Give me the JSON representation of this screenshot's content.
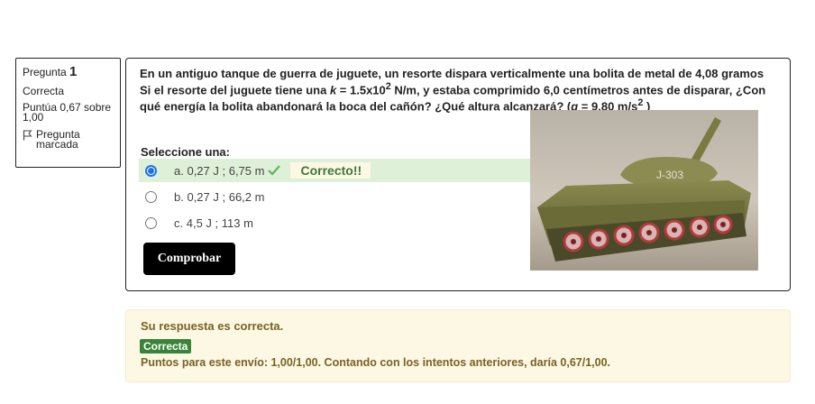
{
  "info": {
    "question_word": "Pregunta",
    "question_number": "1",
    "state": "Correcta",
    "grade": "Puntúa 0,67 sobre 1,00",
    "flag_label": "Pregunta marcada"
  },
  "question": {
    "p1": "En un antiguo tanque de guerra de juguete, un resorte dispara verticalmente una bolita de metal de 4,08 gramos  Si el resorte del juguete tiene una ",
    "k": "k",
    "p2": " = 1.5x10",
    "sup1": "2",
    "p3": "  N/m, y estaba comprimido 6,0 centímetros antes de disparar, ¿Con qué energía la bolita abandonará la boca del cañón? ¿Qué altura alcanzará? (",
    "g": "g",
    "p4": " = 9,80 m/s",
    "sup2": "2",
    "p5": " )",
    "tank_label": "J-303"
  },
  "select_label": "Seleccione una:",
  "options": [
    {
      "letter": "a.",
      "text": "0,27 J ; 6,75 m",
      "selected": true
    },
    {
      "letter": "b.",
      "text": "0,27 J ; 66,2 m",
      "selected": false
    },
    {
      "letter": "c.",
      "text": "4,5 J ; 113 m",
      "selected": false
    }
  ],
  "correct_badge": "Correcto!!",
  "check_button": "Comprobar",
  "feedback": {
    "message": "Su respuesta es correcta.",
    "pill": "Correcta",
    "points": "Puntos para este envío: 1,00/1,00. Contando con los intentos anteriores, daría 0,67/1,00."
  },
  "colors": {
    "correct_bg": "#dff0d8",
    "badge_text": "#3c763d",
    "feedback_bg": "#fcf8e3",
    "pill_bg": "#398439",
    "radio_selected": "#1a73e8"
  },
  "icons": [
    "flag-icon",
    "check-icon",
    "radio-button"
  ]
}
